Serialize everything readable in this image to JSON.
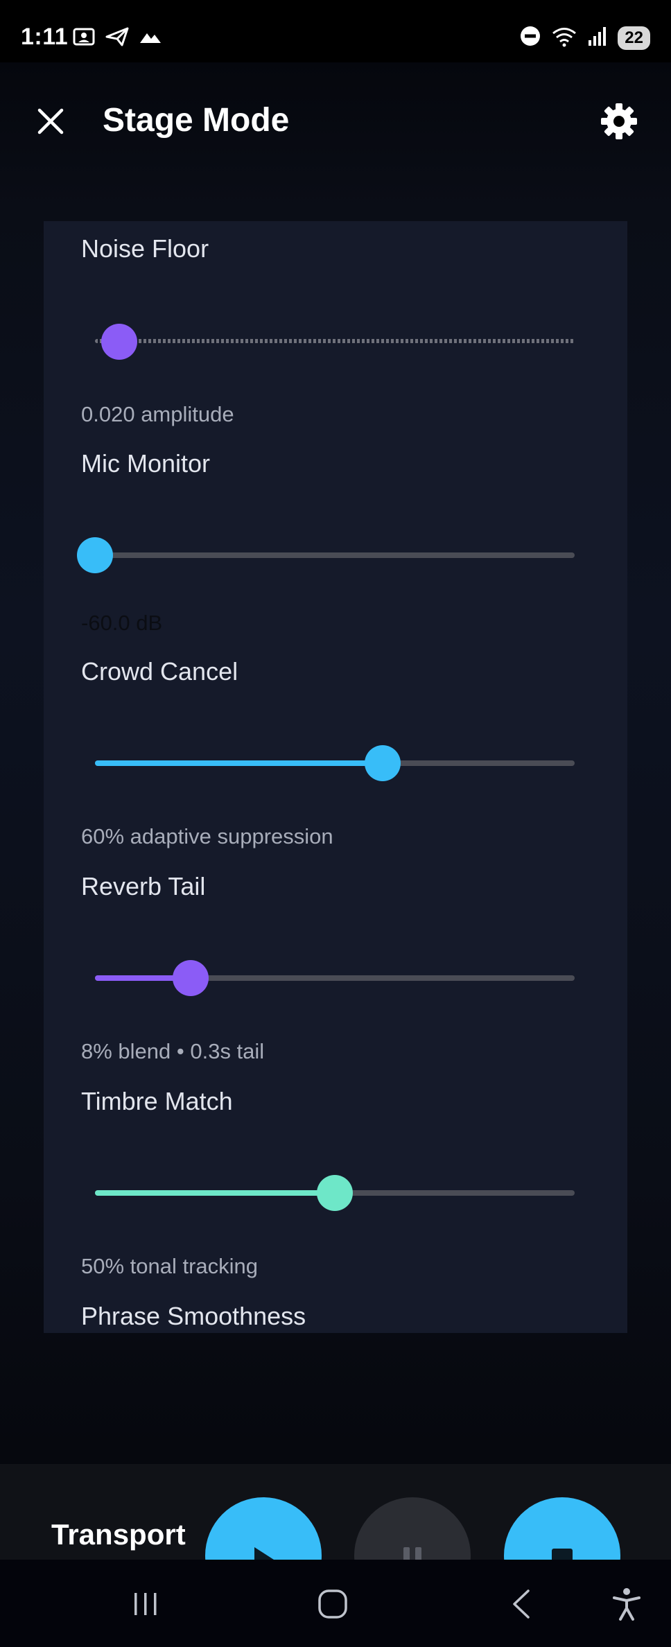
{
  "status_bar": {
    "time": "1:11",
    "left_icons": [
      "screenshot-icon",
      "send-icon",
      "cloud-icon"
    ],
    "right_icons": [
      "do-not-disturb-icon",
      "wifi-icon",
      "signal-icon"
    ],
    "battery": "22"
  },
  "app_bar": {
    "title": "Stage Mode",
    "close_icon": "close-icon",
    "settings_icon": "gear-icon"
  },
  "controls": [
    {
      "label": "Noise Floor",
      "value_text": "0.020 amplitude",
      "level": 0.05,
      "color": "#8b5cf6",
      "style": "dotted"
    },
    {
      "label": "Mic Monitor",
      "value_text": "-60.0 dB",
      "level": 0.0,
      "color": "#38bdf8",
      "style": "solid"
    },
    {
      "label": "Crowd Cancel",
      "value_text": "60% adaptive suppression",
      "level": 0.6,
      "color": "#38bdf8",
      "style": "solid"
    },
    {
      "label": "Reverb Tail",
      "value_text": "8% blend • 0.3s tail",
      "level": 0.2,
      "color": "#8b5cf6",
      "style": "solid"
    },
    {
      "label": "Timbre Match",
      "value_text": "50% tonal tracking",
      "level": 0.5,
      "color": "#6ee7c8",
      "style": "solid"
    },
    {
      "label": "Phrase Smoothness"
    }
  ],
  "transport": {
    "label": "Transport",
    "buttons": [
      {
        "name": "play",
        "icon": "play-icon",
        "color": "#38bdf8"
      },
      {
        "name": "pause",
        "icon": "pause-icon",
        "color": "#2b2d33"
      },
      {
        "name": "stop",
        "icon": "stop-icon",
        "color": "#38bdf8"
      }
    ]
  },
  "nav_bar": {
    "items": [
      "recent-apps-icon",
      "home-icon",
      "back-icon",
      "accessibility-icon"
    ]
  }
}
